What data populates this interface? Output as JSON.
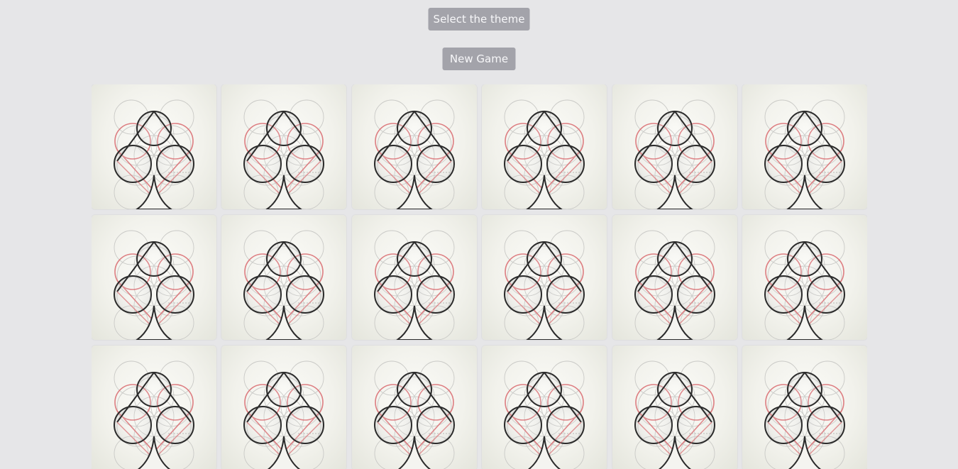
{
  "header": {
    "theme_button_label": "Select the theme",
    "new_game_button_label": "New Game"
  },
  "board": {
    "rows": 3,
    "columns": 6,
    "card_back_icon": "spade-flower-of-life-icon",
    "cards_face_down": 18
  },
  "colors": {
    "page_background": "#e6e6e8",
    "button_background": "#a3a3aa",
    "button_text": "#f7f7f9",
    "card_background": "#f2f2ec",
    "line_dark": "#2b2b2b",
    "line_accent": "#d9696e"
  }
}
